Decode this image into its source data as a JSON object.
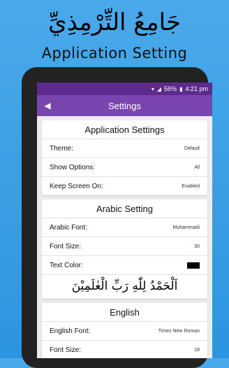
{
  "hero": {
    "arabic_title": "جَامِعُ التِّرْمِذِيِّ",
    "title": "Application Setting"
  },
  "status_bar": {
    "battery": "56%",
    "time": "4:21 pm"
  },
  "app_bar": {
    "title": "Settings"
  },
  "app_settings": {
    "heading": "Application Settings",
    "rows": [
      {
        "label": "Theme:",
        "value": "Default"
      },
      {
        "label": "Show Options:",
        "value": "All"
      },
      {
        "label": "Keep Screen On:",
        "value": "Enabled"
      }
    ]
  },
  "arabic_settings": {
    "heading": "Arabic Setting",
    "font_label": "Arabic Font:",
    "font_value": "Muhammadi",
    "size_label": "Font Size:",
    "size_value": "30",
    "color_label": "Text Color:",
    "color_value": "#000000",
    "preview": "اَلْحَمْدُ لِلّٰهِ رَبِّ الْعٰلَمِيْنَ"
  },
  "english_settings": {
    "heading": "English",
    "font_label": "English Font:",
    "font_value": "Times New Roman",
    "size_label": "Font Size:",
    "size_value": "18"
  },
  "colors": {
    "background": "#3a9fe6",
    "status_bar": "#5e2a8e",
    "app_bar": "#7b45b0"
  }
}
